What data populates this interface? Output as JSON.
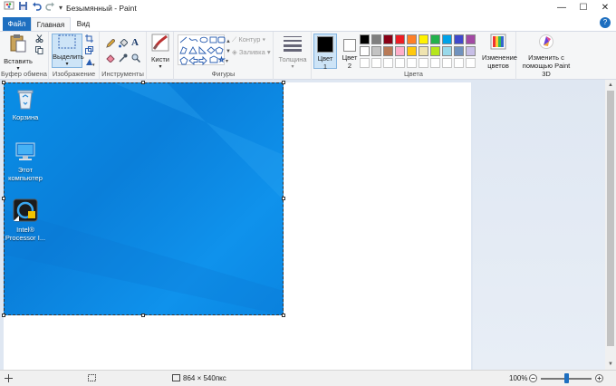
{
  "window": {
    "title": "Безымянный - Paint",
    "controls": {
      "minimize": "—",
      "maximize": "☐",
      "close": "✕"
    }
  },
  "quick_access": {
    "app_icon": "paint-icon",
    "save": "save-icon",
    "undo": "undo-icon",
    "redo": "redo-icon",
    "customize": "▾"
  },
  "tabs": {
    "file": "Файл",
    "home": "Главная",
    "view": "Вид",
    "help": "?"
  },
  "ribbon": {
    "clipboard": {
      "paste": "Вставить",
      "label": "Буфер обмена"
    },
    "image": {
      "select": "Выделить",
      "label": "Изображение"
    },
    "tools": {
      "label": "Инструменты"
    },
    "brushes": {
      "label": "Кисти"
    },
    "shapes": {
      "outline": "Контур",
      "fill": "Заливка",
      "label": "Фигуры"
    },
    "size": {
      "label": "Толщина"
    },
    "colors": {
      "color1_line1": "Цвет",
      "color1_line2": "1",
      "color2_line1": "Цвет",
      "color2_line2": "2",
      "edit_line1": "Изменение",
      "edit_line2": "цветов",
      "label": "Цвета",
      "color1_value": "#000000",
      "color2_value": "#ffffff",
      "palette_row1": [
        "#000000",
        "#7f7f7f",
        "#880015",
        "#ed1c24",
        "#ff7f27",
        "#fff200",
        "#22b14c",
        "#00a2e8",
        "#3f48cc",
        "#a349a4"
      ],
      "palette_row2": [
        "#ffffff",
        "#c3c3c3",
        "#b97a57",
        "#ffaec9",
        "#ffc90e",
        "#efe4b0",
        "#b5e61d",
        "#99d9ea",
        "#7092be",
        "#c8bfe7"
      ]
    },
    "paint3d": {
      "line1": "Изменить с",
      "line2": "помощью Paint 3D"
    }
  },
  "desktop_icons": [
    {
      "line1": "Корзина",
      "line2": "",
      "icon": "recycle-bin-icon"
    },
    {
      "line1": "Этот",
      "line2": "компьютер",
      "icon": "computer-icon"
    },
    {
      "line1": "Intel®",
      "line2": "Processor I...",
      "icon": "intel-processor-icon"
    }
  ],
  "status": {
    "image_size": "864 × 540пкс",
    "zoom": "100%",
    "zoom_fraction": 0.5
  },
  "colors": {
    "accent": "#1e6fc0",
    "desktop_blue": "#0a8ee6"
  }
}
